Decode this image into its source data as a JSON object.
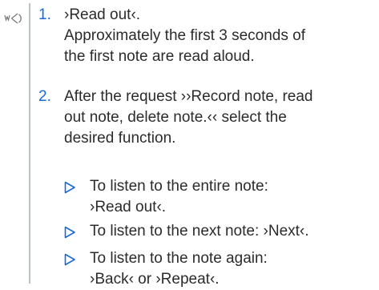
{
  "icons": {
    "voice": "voice-command-icon",
    "option_marker": "triangle-right-icon",
    "accent_color": "#1c69d4",
    "text_color": "#2b2b2b",
    "rule_color": "#b9c1c9"
  },
  "steps": [
    {
      "number": "1.",
      "lines": [
        "›Read out‹.",
        "Approximately the first 3 seconds of",
        "the first note are read aloud."
      ]
    },
    {
      "number": "2.",
      "lines": [
        "After the request ››Record note, read",
        "out note, delete note.‹‹ select the",
        "desired function."
      ]
    }
  ],
  "options": [
    {
      "lines": [
        "To listen to the entire note:",
        "›Read out‹."
      ]
    },
    {
      "lines": [
        "To listen to the next note: ›Next‹."
      ]
    },
    {
      "lines": [
        "To listen to the note again:",
        "›Back‹ or ›Repeat‹."
      ]
    }
  ]
}
